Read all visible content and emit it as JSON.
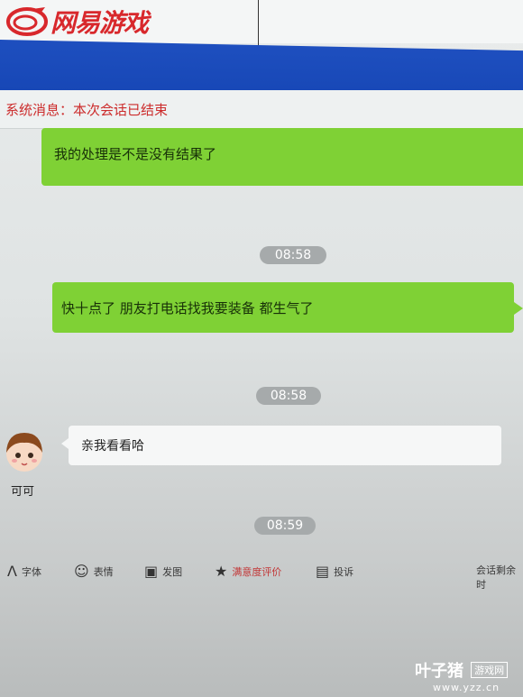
{
  "header": {
    "logo_text": "网易游戏",
    "accent": "#d8282c",
    "bar_color": "#1a4bbb"
  },
  "system_message": "系统消息：本次会话已结束",
  "messages": [
    {
      "side": "out",
      "text": "我的处理是不是没有结果了"
    },
    {
      "side": "out",
      "text": "快十点了  朋友打电话找我要装备   都生气了"
    },
    {
      "side": "in",
      "text": "亲我看看哈",
      "sender": "可可"
    }
  ],
  "timestamps": [
    "08:58",
    "08:58",
    "08:59"
  ],
  "toolbar": {
    "font": "字体",
    "emoji": "表情",
    "image": "发图",
    "rate": "满意度评价",
    "complaint": "投诉",
    "remaining": "会话剩余时"
  },
  "watermark": {
    "name": "叶子猪",
    "box": "游戏网",
    "url": "www.yzz.cn"
  },
  "icons": [
    "logo-icon",
    "font-icon",
    "emoji-icon",
    "image-icon",
    "star-icon",
    "complaint-icon"
  ]
}
